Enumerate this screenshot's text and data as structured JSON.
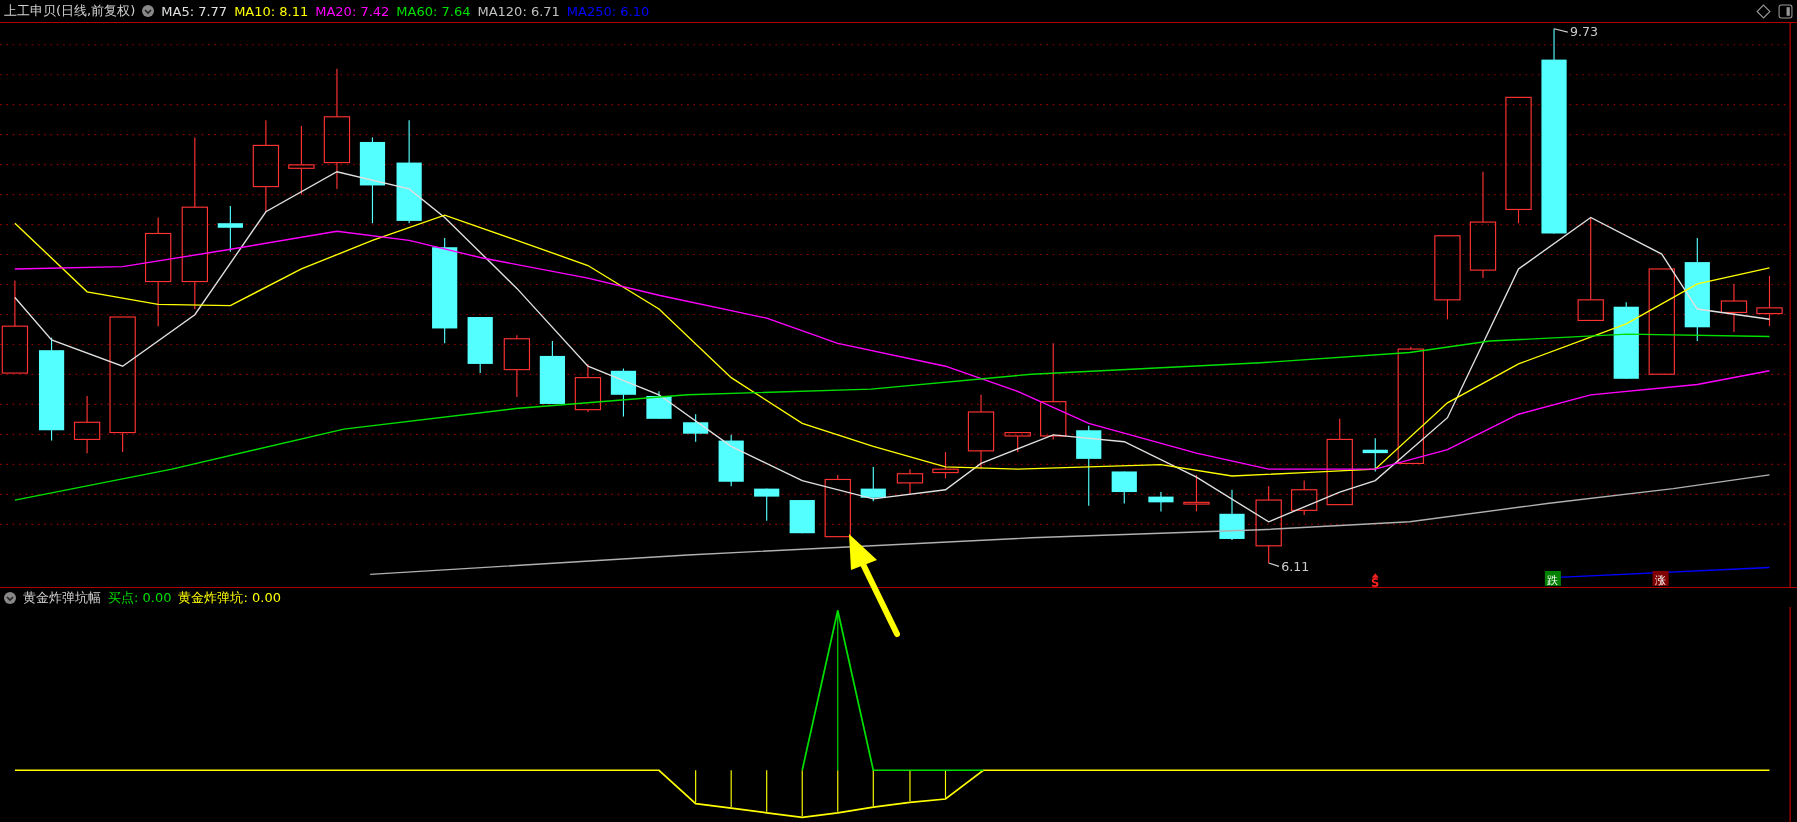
{
  "main_pane": {
    "title": "上工申贝(日线,前复权)",
    "indicators": [
      {
        "label": "MA5: 7.77",
        "color": "#e0e0e0"
      },
      {
        "label": "MA10: 8.11",
        "color": "#ffff00"
      },
      {
        "label": "MA20: 7.42",
        "color": "#ff00ff"
      },
      {
        "label": "MA60: 7.64",
        "color": "#00e000"
      },
      {
        "label": "MA120: 6.71",
        "color": "#c0c0c0"
      },
      {
        "label": "MA250: 6.10",
        "color": "#0000ff"
      }
    ],
    "high_label": "9.73",
    "low_label": "6.11",
    "signals": [
      {
        "kind": "s",
        "text": "S"
      },
      {
        "kind": "fall",
        "text": "跌"
      },
      {
        "kind": "rise",
        "text": "涨"
      }
    ]
  },
  "sub_pane": {
    "title": "黄金炸弹坑幅",
    "values": [
      {
        "label": "买点: 0.00",
        "color": "#00e000"
      },
      {
        "label": "黄金炸弹坑: 0.00",
        "color": "#ffff00"
      }
    ]
  }
}
